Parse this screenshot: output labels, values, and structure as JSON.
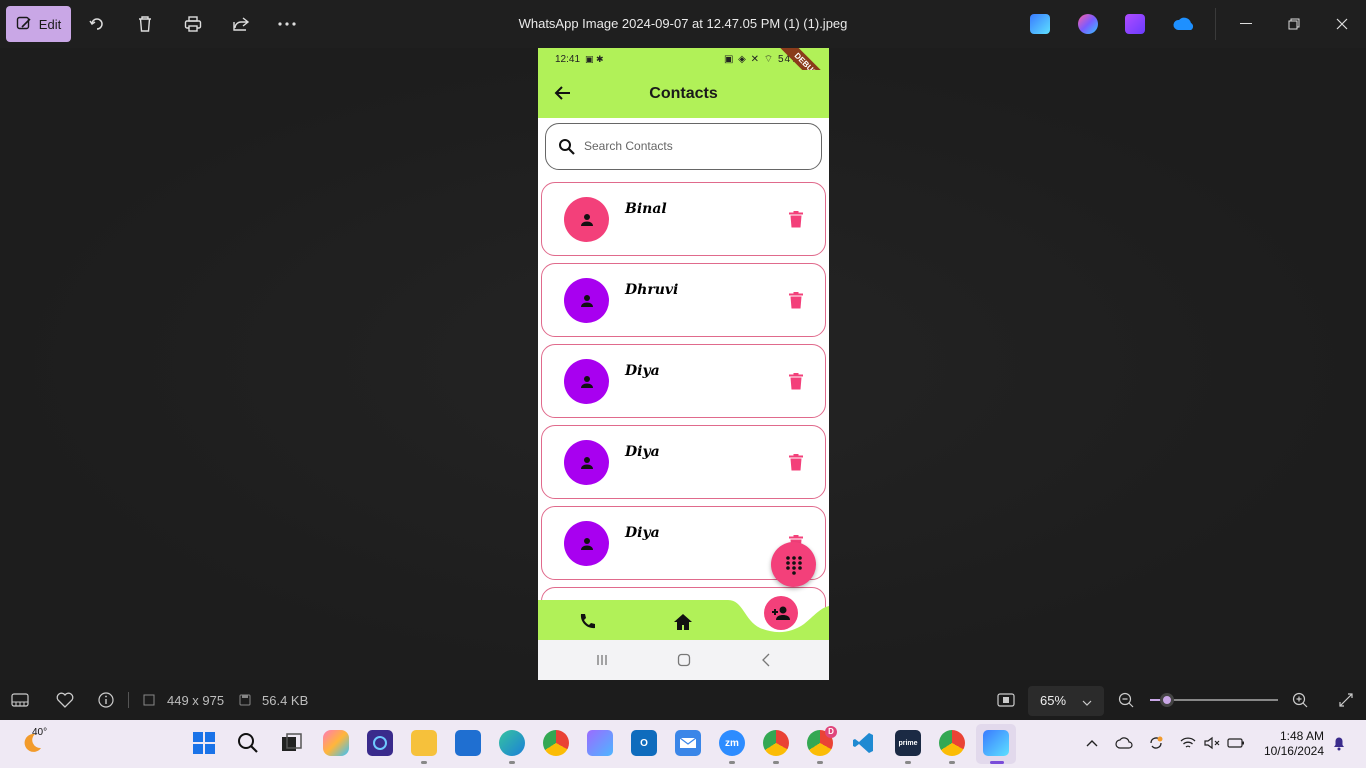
{
  "window": {
    "title": "WhatsApp Image 2024-09-07 at 12.47.05 PM (1) (1).jpeg",
    "edit_label": "Edit",
    "toolbar_icons": [
      "rotate-icon",
      "delete-icon",
      "print-icon",
      "share-icon",
      "more-icon"
    ],
    "app_icons": [
      "photos-edit-icon",
      "copilot-icon",
      "clipchamp-icon",
      "onedrive-icon"
    ]
  },
  "phone": {
    "status_time": "12:41",
    "status_right": "54%",
    "debug_label": "DEBUG",
    "appbar_title": "Contacts",
    "search_placeholder": "Search Contacts",
    "contacts": [
      {
        "name": "Binal",
        "avatar_color": "#f3407a"
      },
      {
        "name": "Dhruvi",
        "avatar_color": "#a800f0"
      },
      {
        "name": "Diya",
        "avatar_color": "#a800f0"
      },
      {
        "name": "Diya",
        "avatar_color": "#a800f0"
      },
      {
        "name": "Diya",
        "avatar_color": "#a800f0"
      }
    ],
    "colors": {
      "appbar": "#b1f158",
      "accent": "#f3407a",
      "card_border": "#e06a8c"
    }
  },
  "infobar": {
    "dimensions": "449 x 975",
    "file_size": "56.4 KB",
    "zoom": "65%",
    "zoom_level_percent": 13
  },
  "taskbar": {
    "weather_temp": "40°",
    "time": "1:48 AM",
    "date": "10/16/2024",
    "chrome_badge": "D"
  }
}
